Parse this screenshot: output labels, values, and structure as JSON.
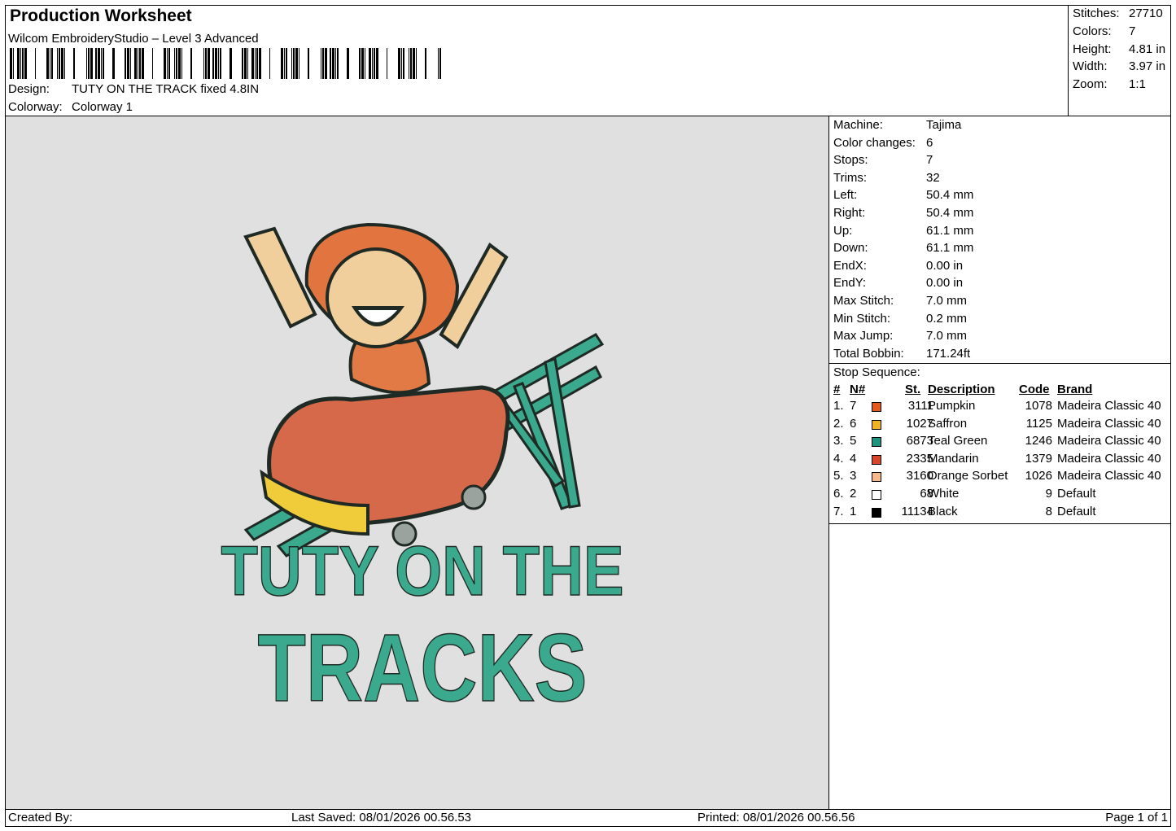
{
  "header": {
    "title": "Production Worksheet",
    "software": "Wilcom EmbroideryStudio – Level 3 Advanced",
    "design_label": "Design:",
    "design_value": "TUTY ON THE TRACK fixed 4.8IN",
    "colorway_label": "Colorway:",
    "colorway_value": "Colorway 1"
  },
  "summary": {
    "stitches_label": "Stitches:",
    "stitches": "27710",
    "colors_label": "Colors:",
    "colors": "7",
    "height_label": "Height:",
    "height": "4.81 in",
    "width_label": "Width:",
    "width": "3.97 in",
    "zoom_label": "Zoom:",
    "zoom": "1:1"
  },
  "machine_info": [
    {
      "label": "Machine:",
      "value": "Tajima"
    },
    {
      "label": "Color changes:",
      "value": "6"
    },
    {
      "label": "Stops:",
      "value": "7"
    },
    {
      "label": "Trims:",
      "value": "32"
    },
    {
      "label": "Left:",
      "value": "50.4 mm"
    },
    {
      "label": "Right:",
      "value": "50.4 mm"
    },
    {
      "label": "Up:",
      "value": "61.1 mm"
    },
    {
      "label": "Down:",
      "value": "61.1 mm"
    },
    {
      "label": "EndX:",
      "value": "0.00 in"
    },
    {
      "label": "EndY:",
      "value": "0.00 in"
    },
    {
      "label": "Max Stitch:",
      "value": "7.0 mm"
    },
    {
      "label": "Min Stitch:",
      "value": "0.2 mm"
    },
    {
      "label": "Max Jump:",
      "value": "7.0 mm"
    },
    {
      "label": "Total Bobbin:",
      "value": "171.24ft"
    }
  ],
  "stop_sequence": {
    "title": "Stop Sequence:",
    "headers": {
      "num": "#",
      "n": "N#",
      "st": "St.",
      "desc": "Description",
      "code": "Code",
      "brand": "Brand"
    },
    "rows": [
      {
        "num": "1.",
        "n": "7",
        "color": "#e4591c",
        "st": "3111",
        "desc": "Pumpkin",
        "code": "1078",
        "brand": "Madeira Classic 40"
      },
      {
        "num": "2.",
        "n": "6",
        "color": "#f0b323",
        "st": "1027",
        "desc": "Saffron",
        "code": "1125",
        "brand": "Madeira Classic 40"
      },
      {
        "num": "3.",
        "n": "5",
        "color": "#1d9480",
        "st": "6873",
        "desc": "Teal Green",
        "code": "1246",
        "brand": "Madeira Classic 40"
      },
      {
        "num": "4.",
        "n": "4",
        "color": "#d9452b",
        "st": "2335",
        "desc": "Mandarin",
        "code": "1379",
        "brand": "Madeira Classic 40"
      },
      {
        "num": "5.",
        "n": "3",
        "color": "#f7b98a",
        "st": "3160",
        "desc": "Orange Sorbet",
        "code": "1026",
        "brand": "Madeira Classic 40"
      },
      {
        "num": "6.",
        "n": "2",
        "color": "#ffffff",
        "st": "68",
        "desc": "White",
        "code": "9",
        "brand": "Default"
      },
      {
        "num": "7.",
        "n": "1",
        "color": "#000000",
        "st": "11134",
        "desc": "Black",
        "code": "8",
        "brand": "Default"
      }
    ]
  },
  "design_art": {
    "line1": "TUTY ON THE",
    "line2": "TRACKS",
    "text_color": "#3aa98e"
  },
  "footer": {
    "created_by": "Created By:",
    "last_saved": "Last Saved: 08/01/2026 00.56.53",
    "printed": "Printed: 08/01/2026 00.56.56",
    "page": "Page 1 of 1"
  }
}
